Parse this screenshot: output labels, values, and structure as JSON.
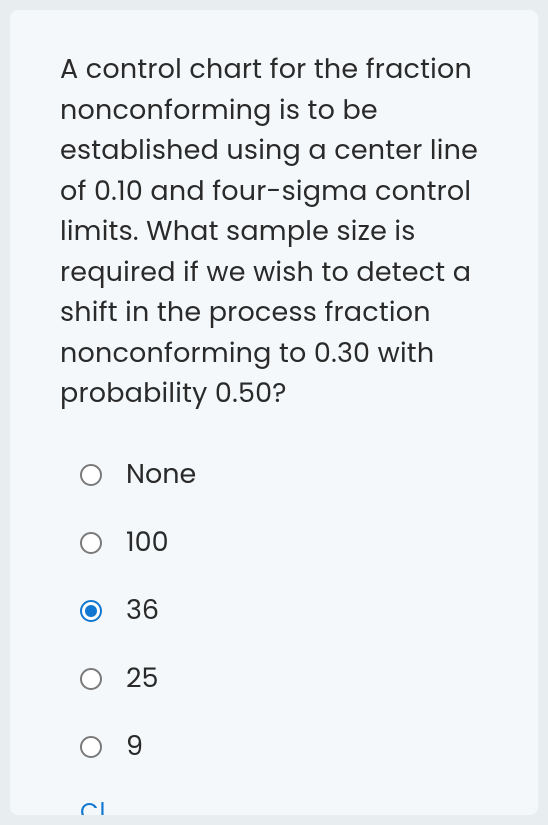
{
  "question": {
    "text": "A control chart for the fraction nonconforming is to be established using a center line of 0.10 and four-sigma control limits. What sample size is required if we wish to detect a shift in the process fraction nonconforming to 0.30 with probability 0.50?"
  },
  "options": [
    {
      "label": "None",
      "selected": false
    },
    {
      "label": "100",
      "selected": false
    },
    {
      "label": "36",
      "selected": true
    },
    {
      "label": "25",
      "selected": false
    },
    {
      "label": "9",
      "selected": false
    }
  ],
  "partial_link": "Cl"
}
